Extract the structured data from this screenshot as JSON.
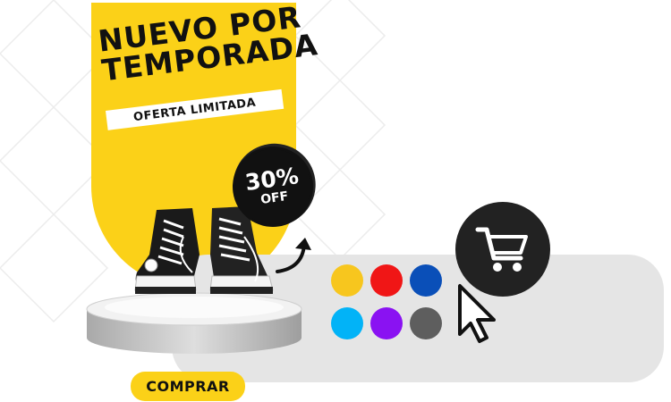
{
  "promo": {
    "headline_line1": "NUEVO POR",
    "headline_line2": "TEMPORADA",
    "offer_label": "OFERTA LIMITADA"
  },
  "discount": {
    "value": "30%",
    "label": "OFF"
  },
  "swatches": [
    {
      "name": "yellow",
      "color": "#f7c61e"
    },
    {
      "name": "red",
      "color": "#f01616"
    },
    {
      "name": "blue",
      "color": "#0a4fb8"
    },
    {
      "name": "sky-blue",
      "color": "#02b3f7"
    },
    {
      "name": "purple",
      "color": "#8a12f2"
    },
    {
      "name": "gray",
      "color": "#5e5e5e"
    }
  ],
  "icons": {
    "cart": "shopping-cart-icon",
    "cursor": "cursor-pointer-icon",
    "arrow": "curved-arrow-icon"
  },
  "cta": {
    "label": "COMPRAR"
  },
  "colors": {
    "brand_yellow": "#fbd118",
    "dark": "#111111",
    "panel_gray": "#e5e5e5"
  }
}
